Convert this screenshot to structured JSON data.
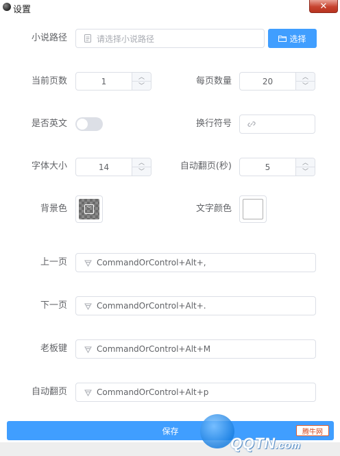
{
  "window": {
    "title": "设置",
    "close_glyph": "✕"
  },
  "form": {
    "novel_path": {
      "label": "小说路径",
      "placeholder": "请选择小说路径",
      "button_label": "选择",
      "prefix_icon": "document-icon",
      "button_icon": "folder-open-icon"
    },
    "current_page": {
      "label": "当前页数",
      "value": "1"
    },
    "page_size": {
      "label": "每页数量",
      "value": "20"
    },
    "english": {
      "label": "是否英文",
      "enabled": false
    },
    "line_break": {
      "label": "换行符号",
      "value": "",
      "prefix_icon": "link-icon"
    },
    "font_size": {
      "label": "字体大小",
      "value": "14"
    },
    "auto_page_seconds": {
      "label": "自动翻页(秒)",
      "value": "5"
    },
    "background_color": {
      "label": "背景色",
      "color": "transparent"
    },
    "text_color": {
      "label": "文字颜色",
      "color": "#ffffff"
    },
    "prev_page": {
      "label": "上一页",
      "value": "CommandOrControl+Alt+,"
    },
    "next_page": {
      "label": "下一页",
      "value": "CommandOrControl+Alt+."
    },
    "boss_key": {
      "label": "老板键",
      "value": "CommandOrControl+Alt+M"
    },
    "auto_page": {
      "label": "自动翻页",
      "value": "CommandOrControl+Alt+p"
    },
    "shortcut_icon": "keyboard-icon"
  },
  "actions": {
    "save_label": "保存"
  },
  "watermark": {
    "brand": "QQTN",
    "domain_suffix": ".com",
    "badge": "腾牛网"
  },
  "colors": {
    "accent": "#409eff",
    "border": "#dcdfe6",
    "label": "#606266"
  }
}
